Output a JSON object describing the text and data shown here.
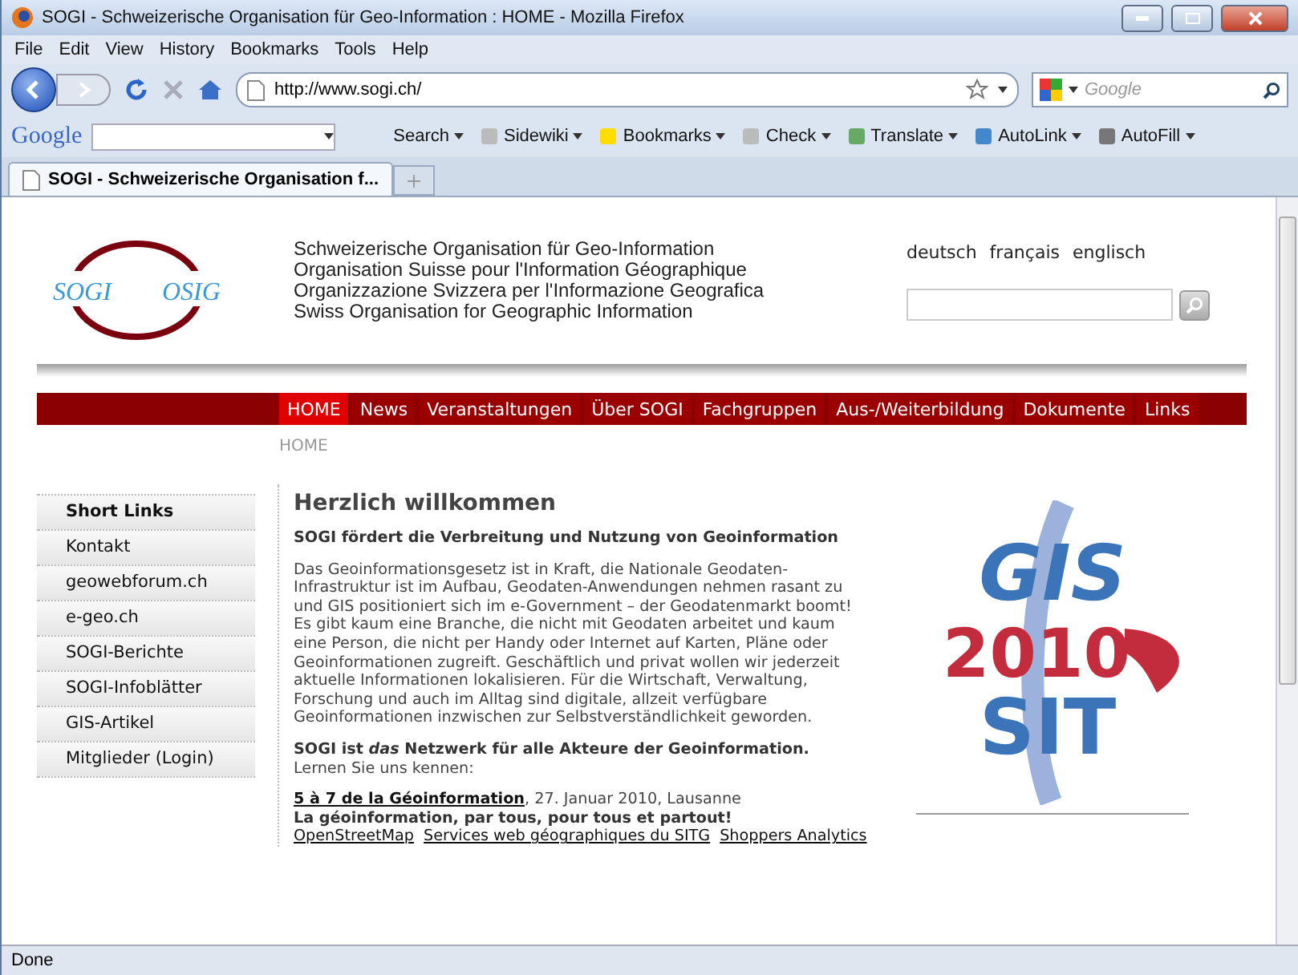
{
  "window": {
    "title": "SOGI - Schweizerische Organisation für Geo-Information : HOME - Mozilla Firefox"
  },
  "menu_bar": [
    "File",
    "Edit",
    "View",
    "History",
    "Bookmarks",
    "Tools",
    "Help"
  ],
  "navigation": {
    "address": "http://www.sogi.ch/",
    "search_placeholder": "Google"
  },
  "google_toolbar": {
    "logo": "Google",
    "items": [
      {
        "label": "Search"
      },
      {
        "label": "Sidewiki"
      },
      {
        "label": "Bookmarks"
      },
      {
        "label": "Check"
      },
      {
        "label": "Translate"
      },
      {
        "label": "AutoLink"
      },
      {
        "label": "AutoFill"
      }
    ]
  },
  "tabs": [
    {
      "label": "SOGI - Schweizerische Organisation f...",
      "selected": true
    }
  ],
  "page": {
    "logo": {
      "left": "SOGI",
      "right": "OSIG"
    },
    "org_names": [
      "Schweizerische Organisation für Geo-Information",
      "Organisation Suisse pour l'Information Géographique",
      "Organizzazione Svizzera per l'Informazione Geografica",
      "Swiss Organisation for Geographic Information"
    ],
    "languages": [
      "deutsch",
      "français",
      "englisch"
    ],
    "nav": [
      {
        "label": "HOME",
        "selected": true
      },
      {
        "label": "News",
        "selected": false
      },
      {
        "label": "Veranstaltungen",
        "selected": false
      },
      {
        "label": "Über SOGI",
        "selected": false
      },
      {
        "label": "Fachgruppen",
        "selected": false
      },
      {
        "label": "Aus-/Weiterbildung",
        "selected": false
      },
      {
        "label": "Dokumente",
        "selected": false
      },
      {
        "label": "Links",
        "selected": false
      }
    ],
    "breadcrumb": "HOME",
    "sidebar": {
      "title": "Short Links",
      "items": [
        "Kontakt",
        "geowebforum.ch",
        "e-geo.ch",
        "SOGI-Berichte",
        "SOGI-Infoblätter",
        "GIS-Artikel",
        "Mitglieder (Login)"
      ]
    },
    "heading": "Herzlich willkommen",
    "subheading": "SOGI fördert die Verbreitung und Nutzung von Geoinformation",
    "body": "Das Geoinformationsgesetz ist in Kraft, die Nationale Geodaten-Infrastruktur ist im Aufbau, Geodaten-Anwendungen nehmen rasant zu und GIS positioniert sich im e-Government – der Geodatenmarkt boomt! Es gibt kaum eine Branche, die nicht mit Geodaten arbeitet und kaum eine Person, die nicht per Handy oder Internet auf Karten, Pläne oder Geoinformationen zugreift. Geschäftlich und privat wollen wir jederzeit aktuelle Informationen lokalisieren. Für die Wirtschaft, Verwaltung, Forschung und auch im Alltag sind digitale, allzeit verfügbare Geoinformationen inzwischen zur Selbstverständlichkeit geworden.",
    "network": "**SOGI ist *das* Netzwerk für alle Akteure der Geoinformation.**",
    "network_sub": "Lernen Sie uns kennen:",
    "event": {
      "link": "5 à 7 de la Géoinformation",
      "details": ", 27. Januar 2010, Lausanne",
      "tagline": "La géoinformation, par tous, pour tous et partout!",
      "links": [
        "OpenStreetMap",
        "Services web géographiques du SITG",
        "Shoppers Analytics"
      ]
    },
    "event_logo": {
      "top": "GIS",
      "middle": "2010",
      "bottom": "SIT"
    }
  },
  "status_bar": "Done"
}
